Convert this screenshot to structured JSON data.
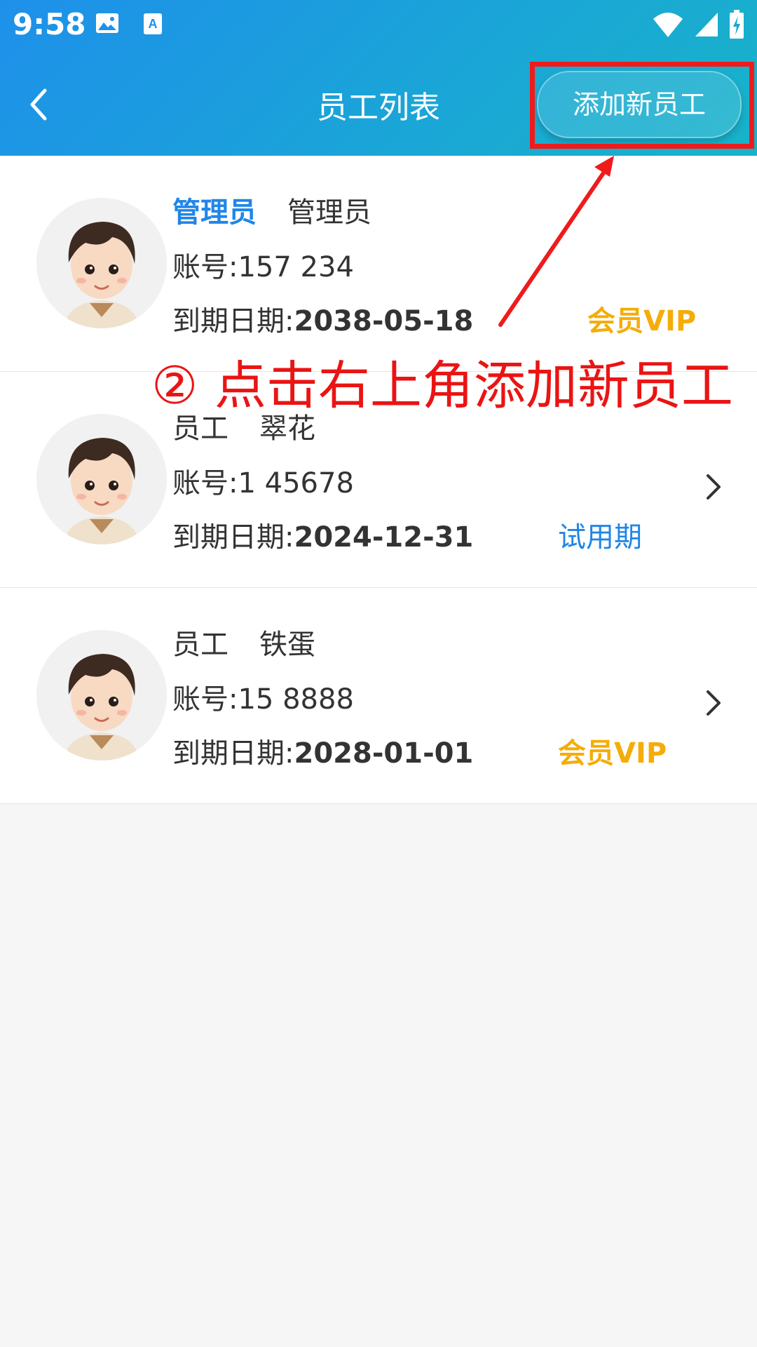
{
  "status_bar": {
    "time": "9:58",
    "icons_left": [
      "image-icon",
      "text-icon"
    ],
    "icons_right": [
      "wifi-icon",
      "signal-icon",
      "battery-charging-icon"
    ]
  },
  "navbar": {
    "title": "员工列表",
    "back_icon": "chevron-left-icon",
    "add_button_label": "添加新员工"
  },
  "employees": [
    {
      "role": "管理员",
      "name": "管理员",
      "account_label": "账号:",
      "account": "157      234",
      "expiry_label": "到期日期:",
      "expiry_date": "2038-05-18",
      "badge": "会员VIP"
    },
    {
      "role": "员工",
      "name": "翠花",
      "account_label": "账号:",
      "account": "1     45678",
      "expiry_label": "到期日期:",
      "expiry_date": "2024-12-31",
      "badge": "试用期"
    },
    {
      "role": "员工",
      "name": "铁蛋",
      "account_label": "账号:",
      "account": "15       8888",
      "expiry_label": "到期日期:",
      "expiry_date": "2028-01-01",
      "badge": "会员VIP"
    }
  ],
  "annotation": {
    "text": "② 点击右上角添加新员工",
    "color": "#ea1414"
  },
  "colors": {
    "header_gradient_start": "#1e90ea",
    "header_gradient_end": "#18b3c9",
    "admin_role": "#1f86e8",
    "vip": "#f4ad08",
    "trial": "#1f86e8"
  }
}
